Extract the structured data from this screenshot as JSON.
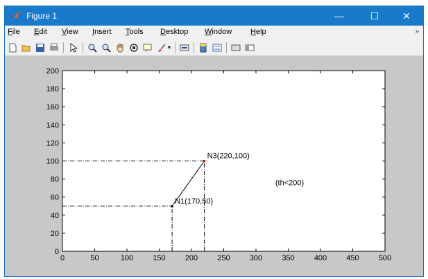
{
  "window": {
    "title": "Figure 1",
    "controls": {
      "minimize": "—",
      "maximize": "☐",
      "close": "✕"
    }
  },
  "menu": {
    "items": [
      {
        "mnemonic": "F",
        "rest": "ile"
      },
      {
        "mnemonic": "E",
        "rest": "dit"
      },
      {
        "mnemonic": "V",
        "rest": "iew"
      },
      {
        "mnemonic": "I",
        "rest": "nsert"
      },
      {
        "mnemonic": "T",
        "rest": "ools"
      },
      {
        "mnemonic": "D",
        "rest": "esktop"
      },
      {
        "mnemonic": "W",
        "rest": "indow"
      },
      {
        "mnemonic": "H",
        "rest": "elp"
      }
    ],
    "overflow_icon": "double-chevron-icon"
  },
  "toolbar": {
    "icons": [
      "new-figure-icon",
      "open-file-icon",
      "save-icon",
      "print-icon",
      "pointer-icon",
      "zoom-in-icon",
      "zoom-out-icon",
      "pan-hand-icon",
      "rotate-3d-icon",
      "data-cursor-icon",
      "brush-icon",
      "link-plot-icon",
      "colorbar-icon",
      "legend-icon",
      "hide-plot-tools-icon",
      "show-plot-tools-icon"
    ]
  },
  "chart_data": {
    "type": "line",
    "xlim": [
      0,
      500
    ],
    "ylim": [
      0,
      200
    ],
    "xticks": [
      0,
      50,
      100,
      150,
      200,
      250,
      300,
      350,
      400,
      450,
      500
    ],
    "yticks": [
      0,
      20,
      40,
      60,
      80,
      100,
      120,
      140,
      160,
      180,
      200
    ],
    "grid": false,
    "series": [
      {
        "x": [
          170,
          220
        ],
        "y": [
          50,
          100
        ],
        "style": "solid",
        "color": "#000000"
      }
    ],
    "guides": [
      {
        "x": [
          0,
          170
        ],
        "y": [
          50,
          50
        ],
        "style": "dashdot"
      },
      {
        "x": [
          170,
          170
        ],
        "y": [
          0,
          50
        ],
        "style": "dashdot"
      },
      {
        "x": [
          0,
          220
        ],
        "y": [
          100,
          100
        ],
        "style": "dashdot"
      },
      {
        "x": [
          220,
          220
        ],
        "y": [
          0,
          100
        ],
        "style": "dashdot"
      }
    ],
    "points": [
      {
        "x": 170,
        "y": 50,
        "label": "N1(170,50)",
        "marker": "#000000"
      },
      {
        "x": 220,
        "y": 100,
        "label": "N3(220,100)",
        "marker": "#cc0000"
      }
    ],
    "annotations": [
      {
        "x": 330,
        "y": 73,
        "text": "(th<200)"
      }
    ]
  }
}
